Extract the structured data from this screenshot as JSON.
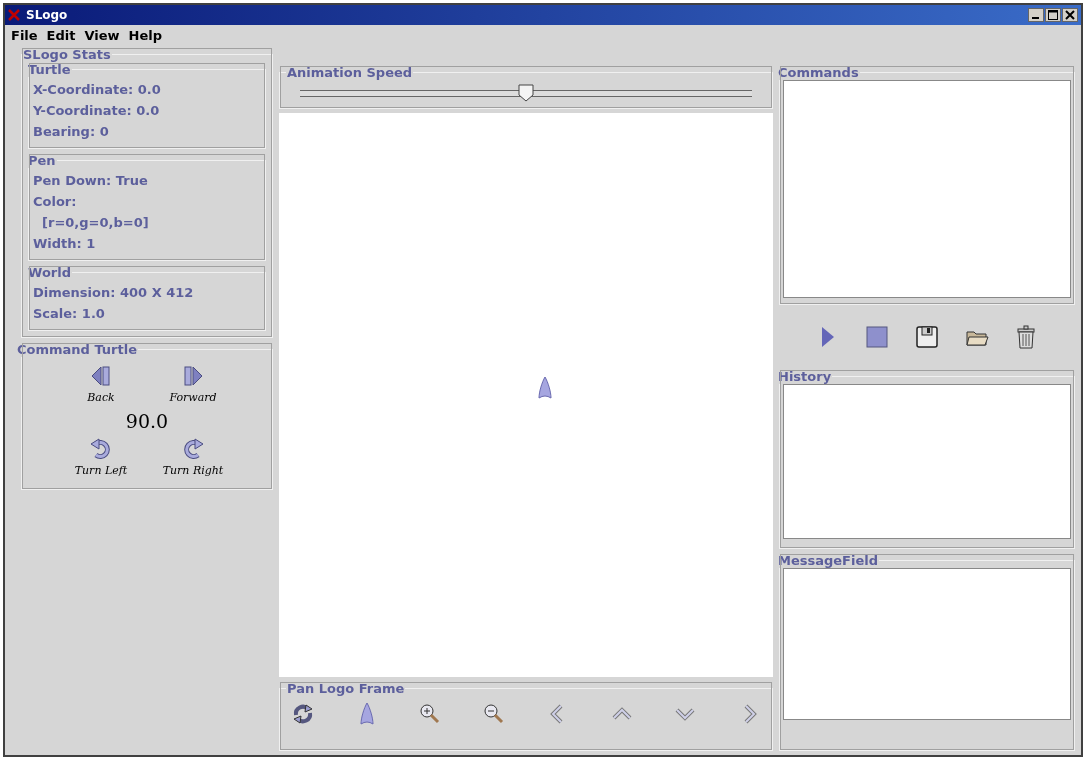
{
  "window": {
    "title": "SLogo"
  },
  "menu": [
    "File",
    "Edit",
    "View",
    "Help"
  ],
  "stats": {
    "title": "SLogo Stats",
    "groups": [
      {
        "title": "Turtle",
        "lines": [
          "X-Coordinate: 0.0",
          "Y-Coordinate: 0.0",
          "Bearing: 0"
        ]
      },
      {
        "title": "Pen",
        "lines": [
          "Pen Down: True",
          "Color:",
          "  [r=0,g=0,b=0]",
          "Width: 1"
        ]
      },
      {
        "title": "World",
        "lines": [
          "Dimension: 400 X 412",
          "Scale: 1.0"
        ]
      }
    ]
  },
  "command_turtle": {
    "title": "Command Turtle",
    "move_buttons": [
      {
        "kind": "back",
        "label": "Back"
      },
      {
        "kind": "forward",
        "label": "Forward"
      }
    ],
    "value": "90.0",
    "turn_buttons": [
      {
        "kind": "left",
        "label": "Turn Left"
      },
      {
        "kind": "right",
        "label": "Turn Right"
      }
    ]
  },
  "animation_speed": {
    "title": "Animation Speed",
    "level": 0.5
  },
  "pan": {
    "title": "Pan Logo Frame",
    "buttons": [
      {
        "kind": "refresh"
      },
      {
        "kind": "turtle"
      },
      {
        "kind": "zoom_in"
      },
      {
        "kind": "zoom_out"
      },
      {
        "kind": "left"
      },
      {
        "kind": "up"
      },
      {
        "kind": "down"
      },
      {
        "kind": "right"
      }
    ]
  },
  "commands": {
    "title": "Commands",
    "buttons": [
      {
        "kind": "run"
      },
      {
        "kind": "stop"
      },
      {
        "kind": "save"
      },
      {
        "kind": "open"
      },
      {
        "kind": "delete"
      }
    ]
  },
  "history": {
    "title": "History"
  },
  "message_field": {
    "title": "MessageField"
  }
}
